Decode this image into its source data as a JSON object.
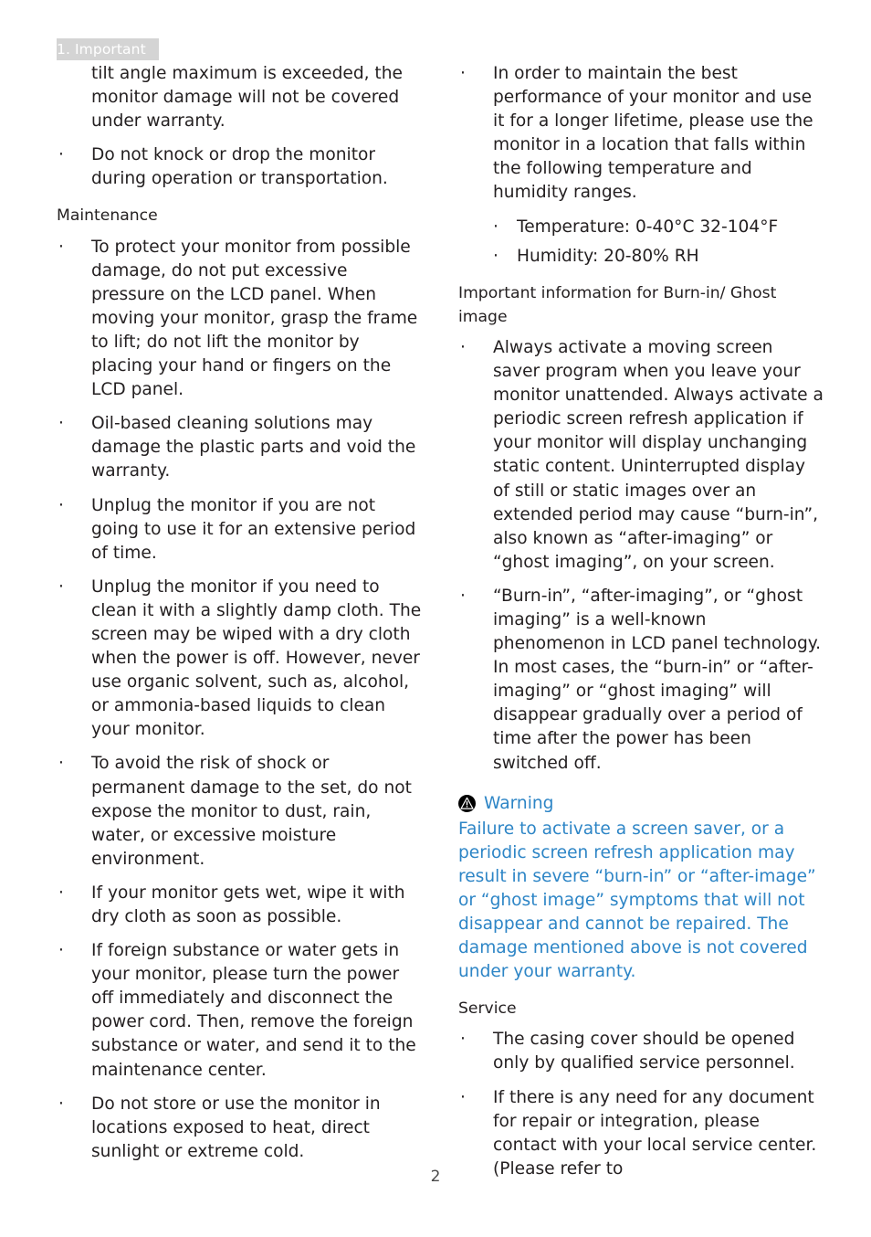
{
  "header": {
    "chapter_tag": "1. Important"
  },
  "page_number": "2",
  "warning_icon_name": "warning-triangle-icon",
  "colors": {
    "text": "#231f20",
    "warning_blue": "#2d85c6",
    "header_tag_bg": "#d4d4d4",
    "header_tag_text": "#ffffff"
  },
  "bullet_glyph": "·",
  "left_column": {
    "continuation_paragraph": "tilt angle maximum is exceeded, the monitor damage will not be covered under warranty.",
    "bullets_top": [
      "Do not knock or drop the monitor during operation or transportation."
    ],
    "maintenance_heading": "Maintenance",
    "maintenance_bullets": [
      "To protect your monitor from possible damage, do not put excessive pressure on the LCD panel. When moving your monitor, grasp the frame to lift; do not lift the monitor by placing your hand or fingers on the LCD panel.",
      "Oil-based cleaning solutions may damage the plastic parts and void the warranty.",
      "Unplug the monitor if you are not going to use it for an extensive period of time.",
      "Unplug the monitor if you need to clean it with a slightly damp cloth. The screen may be wiped with a dry cloth when the power is off. However, never use organic solvent, such as, alcohol, or ammonia-based liquids to clean your monitor.",
      "To avoid the risk of shock or permanent damage to the set, do not expose the monitor to dust, rain, water, or excessive moisture environment.",
      "If your monitor gets wet, wipe it with dry cloth as soon as possible.",
      "If foreign substance or water gets in your monitor, please turn the power off immediately and disconnect the power cord. Then, remove the foreign substance or water, and send it to the maintenance center.",
      "Do not store or use the monitor in locations exposed to heat, direct sunlight or extreme cold."
    ]
  },
  "right_column": {
    "top_bullet": "In order to maintain the best performance of your monitor and use it for a longer lifetime, please use the monitor in a location that falls within the following temperature and humidity ranges.",
    "top_subbullets": [
      "Temperature: 0-40°C 32-104°F",
      "Humidity: 20-80% RH"
    ],
    "burnin_heading": "Important information for Burn-in/ Ghost image",
    "burnin_bullets": [
      "Always activate a moving screen saver program when you leave your monitor unattended. Always activate a periodic screen refresh application if your monitor will display unchanging static content. Uninterrupted display of still or static images over an extended period may cause “burn-in”, also known as “after-imaging” or “ghost imaging”, on your screen.",
      "“Burn-in”, “after-imaging”, or “ghost imaging” is a well-known phenomenon in LCD panel technology. In most cases, the “burn-in” or “after-imaging” or “ghost imaging” will disappear gradually over a period of time after the power has been switched off."
    ],
    "warning": {
      "title": "Warning",
      "body": "Failure to activate a screen saver, or a periodic screen refresh application may result in severe “burn-in” or “after-image” or “ghost image” symptoms that will not disappear and cannot be repaired. The damage mentioned above is not covered under your warranty."
    },
    "service_heading": "Service",
    "service_bullets": [
      "The casing cover should be opened only by qualified service personnel.",
      "If there is any need for any document for repair or integration, please contact with your local service center. (Please refer to"
    ]
  }
}
